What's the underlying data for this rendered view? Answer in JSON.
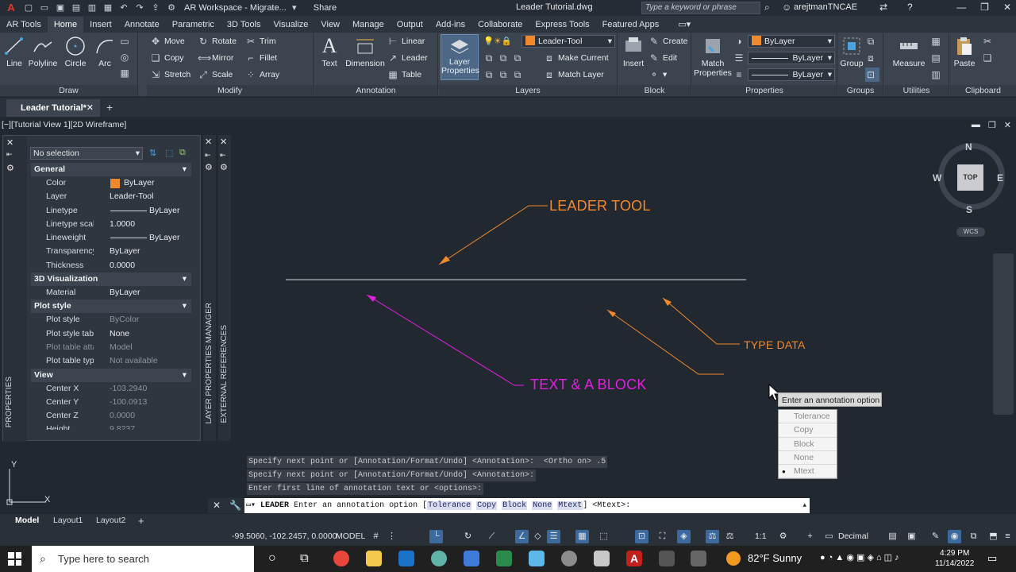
{
  "titlebar": {
    "workspace": "AR Workspace - Migrate...",
    "share": "Share",
    "doc_title": "Leader Tutorial.dwg",
    "search_placeholder": "Type a keyword or phrase",
    "user": "arejtmanTNCAE"
  },
  "ribbon_tabs": [
    "AR Tools",
    "Home",
    "Insert",
    "Annotate",
    "Parametric",
    "3D Tools",
    "Visualize",
    "View",
    "Manage",
    "Output",
    "Add-ins",
    "Collaborate",
    "Express Tools",
    "Featured Apps"
  ],
  "active_tab": "Home",
  "draw": {
    "title": "Draw",
    "line": "Line",
    "polyline": "Polyline",
    "circle": "Circle",
    "arc": "Arc"
  },
  "modify": {
    "title": "Modify",
    "move": "Move",
    "rotate": "Rotate",
    "trim": "Trim",
    "copy": "Copy",
    "mirror": "Mirror",
    "fillet": "Fillet",
    "stretch": "Stretch",
    "scale": "Scale",
    "array": "Array"
  },
  "annotation": {
    "title": "Annotation",
    "text": "Text",
    "dimension": "Dimension",
    "linear": "Linear",
    "leader": "Leader",
    "table": "Table"
  },
  "layers": {
    "title": "Layers",
    "layer_properties": "Layer Properties",
    "current_layer": "Leader-Tool",
    "make_current": "Make Current",
    "match_layer": "Match Layer"
  },
  "block": {
    "title": "Block",
    "insert": "Insert",
    "create": "Create",
    "edit": "Edit"
  },
  "properties_panel": {
    "title": "Properties",
    "match": "Match Properties",
    "color": "ByLayer",
    "linetype": "ByLayer",
    "lineweight": "ByLayer"
  },
  "groups": {
    "title": "Groups",
    "group": "Group"
  },
  "utilities": {
    "title": "Utilities",
    "measure": "Measure"
  },
  "clipboard": {
    "title": "Clipboard",
    "paste": "Paste"
  },
  "doc_tab": "Leader Tutorial*",
  "viewport_label": "[−][Tutorial View 1][2D Wireframe]",
  "props": {
    "selection": "No selection",
    "strip_label": "PROPERTIES",
    "general_title": "General",
    "general": [
      {
        "k": "Color",
        "v": "ByLayer"
      },
      {
        "k": "Layer",
        "v": "Leader-Tool"
      },
      {
        "k": "Linetype",
        "v": "ByLayer"
      },
      {
        "k": "Linetype scale",
        "v": "1.0000"
      },
      {
        "k": "Lineweight",
        "v": "ByLayer"
      },
      {
        "k": "Transparency",
        "v": "ByLayer"
      },
      {
        "k": "Thickness",
        "v": "0.0000"
      }
    ],
    "viz_title": "3D Visualization",
    "viz": [
      {
        "k": "Material",
        "v": "ByLayer"
      }
    ],
    "plot_title": "Plot style",
    "plot": [
      {
        "k": "Plot style",
        "v": "ByColor"
      },
      {
        "k": "Plot style table",
        "v": "None"
      },
      {
        "k": "Plot table atta...",
        "v": "Model"
      },
      {
        "k": "Plot table type",
        "v": "Not available"
      }
    ],
    "view_title": "View",
    "view": [
      {
        "k": "Center X",
        "v": "-103.2940"
      },
      {
        "k": "Center Y",
        "v": "-100.0913"
      },
      {
        "k": "Center Z",
        "v": "0.0000"
      },
      {
        "k": "Height",
        "v": "9.8237"
      }
    ]
  },
  "strips": {
    "layer_props_manager": "LAYER PROPERTIES MANAGER",
    "external_refs": "EXTERNAL REFERENCES"
  },
  "drawing": {
    "leader_tool": "LEADER TOOL",
    "type_data": "TYPE DATA",
    "text_block": "TEXT & A BLOCK",
    "orange": "#f0892c",
    "magenta": "#e31fe0",
    "line": "#d8d8d8"
  },
  "viewcube": {
    "n": "N",
    "s": "S",
    "e": "E",
    "w": "W",
    "top": "TOP",
    "wcs": "WCS"
  },
  "tooltip": "Enter an annotation option",
  "options": [
    "Tolerance",
    "Copy",
    "Block",
    "None",
    "Mtext"
  ],
  "selected_option": "Mtext",
  "history": [
    "Specify next point or [Annotation/Format/Undo] <Annotation>:  <Ortho on> .5",
    "Specify next point or [Annotation/Format/Undo] <Annotation>:",
    "Enter first line of annotation text or <options>:"
  ],
  "command": {
    "name": "LEADER",
    "prompt": " Enter an annotation option [",
    "opts": [
      "Tolerance",
      "Copy",
      "Block",
      "None",
      "Mtext"
    ],
    "suffix": "] <Mtext>:"
  },
  "layout_tabs": [
    "Model",
    "Layout1",
    "Layout2"
  ],
  "status": {
    "coords": "-99.5060, -102.2457, 0.0000",
    "model": "MODEL",
    "scale": "1:1",
    "units": "Decimal"
  },
  "taskbar": {
    "search": "Type here to search",
    "weather": "82°F  Sunny",
    "time": "4:29 PM",
    "date": "11/14/2022"
  }
}
